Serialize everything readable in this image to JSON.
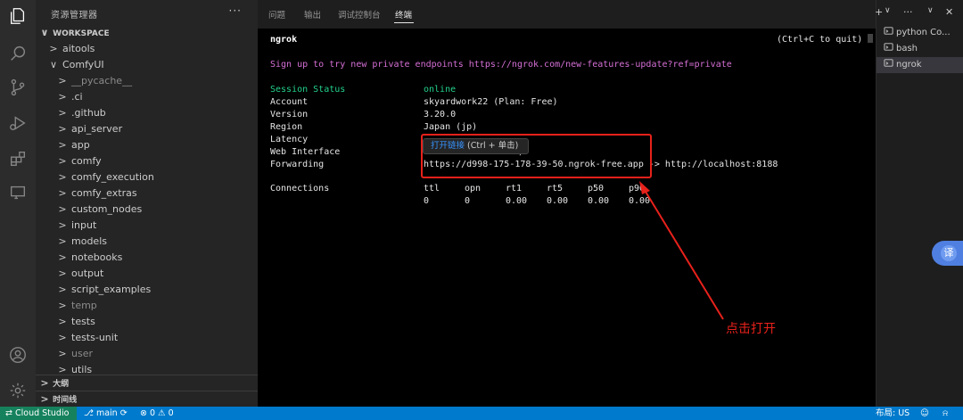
{
  "sidebar": {
    "title": "资源管理器",
    "more": "···",
    "workspace_label": "WORKSPACE",
    "tree": [
      {
        "label": "aitools",
        "chev": ">",
        "dim": false
      },
      {
        "label": "ComfyUI",
        "chev": "∨",
        "dim": false
      },
      {
        "label": "__pycache__",
        "chev": ">",
        "dim": true
      },
      {
        "label": ".ci",
        "chev": ">",
        "dim": false
      },
      {
        "label": ".github",
        "chev": ">",
        "dim": false
      },
      {
        "label": "api_server",
        "chev": ">",
        "dim": false
      },
      {
        "label": "app",
        "chev": ">",
        "dim": false
      },
      {
        "label": "comfy",
        "chev": ">",
        "dim": false
      },
      {
        "label": "comfy_execution",
        "chev": ">",
        "dim": false
      },
      {
        "label": "comfy_extras",
        "chev": ">",
        "dim": false
      },
      {
        "label": "custom_nodes",
        "chev": ">",
        "dim": false
      },
      {
        "label": "input",
        "chev": ">",
        "dim": false
      },
      {
        "label": "models",
        "chev": ">",
        "dim": false
      },
      {
        "label": "notebooks",
        "chev": ">",
        "dim": false
      },
      {
        "label": "output",
        "chev": ">",
        "dim": false
      },
      {
        "label": "script_examples",
        "chev": ">",
        "dim": false
      },
      {
        "label": "temp",
        "chev": ">",
        "dim": true
      },
      {
        "label": "tests",
        "chev": ">",
        "dim": false
      },
      {
        "label": "tests-unit",
        "chev": ">",
        "dim": false
      },
      {
        "label": "user",
        "chev": ">",
        "dim": true
      },
      {
        "label": "utils",
        "chev": ">",
        "dim": false
      }
    ],
    "outline_label": "大纲",
    "timeline_label": "时间线"
  },
  "panel": {
    "tabs": [
      "问题",
      "输出",
      "调试控制台",
      "终端"
    ],
    "active_tab": "终端"
  },
  "terminal": {
    "title": "ngrok",
    "quit_hint": "(Ctrl+C to quit)",
    "signup": "Sign up to try new private endpoints https://ngrok.com/new-features-update?ref=private",
    "rows": [
      {
        "key": "Session Status",
        "value": "online"
      },
      {
        "key": "Account",
        "value": "skyardwork22 (Plan: Free)"
      },
      {
        "key": "Version",
        "value": "3.20.0"
      },
      {
        "key": "Region",
        "value": "Japan (jp)"
      },
      {
        "key": "Latency",
        "value": ""
      },
      {
        "key": "Web Interface",
        "value": ")"
      },
      {
        "key": "Forwarding",
        "value": "https://d998-175-178-39-50.ngrok-free.app -> http://localhost:8188"
      }
    ],
    "connections_label": "Connections",
    "conn_headers": [
      "ttl",
      "opn",
      "rt1",
      "rt5",
      "p50",
      "p90"
    ],
    "conn_values": [
      "0",
      "0",
      "0.00",
      "0.00",
      "0.00",
      "0.00"
    ],
    "tooltip_link": "打开链接",
    "tooltip_hint": " (Ctrl + 单击)"
  },
  "annotation": {
    "text": "点击打开",
    "color": "#e8211b"
  },
  "terminal_list": {
    "actions": [
      "+",
      "∨",
      "···",
      "∨",
      "✕"
    ],
    "items": [
      {
        "label": "python Co...",
        "selected": false
      },
      {
        "label": "bash",
        "selected": false
      },
      {
        "label": "ngrok",
        "selected": true
      }
    ],
    "translate_label": "译"
  },
  "statusbar": {
    "remote": "Cloud Studio",
    "branch": "main",
    "sync_icon": "sync-icon",
    "problems": "⊗ 0 ⚠ 0",
    "layout": "布局: US",
    "colors": {
      "bar": "#007acc",
      "remote": "#16825d"
    }
  }
}
